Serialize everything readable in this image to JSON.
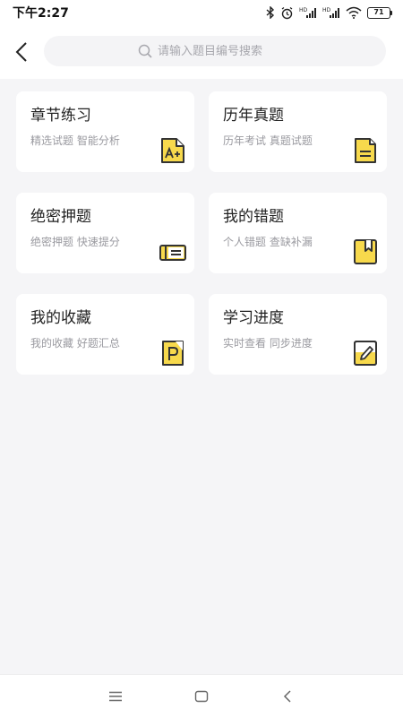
{
  "status_bar": {
    "time": "下午2:27",
    "battery": "71"
  },
  "search": {
    "placeholder": "请输入题目编号搜索"
  },
  "cards": [
    {
      "title": "章节练习",
      "subtitle": "精选试题 智能分析",
      "icon": "grade-a-plus-icon"
    },
    {
      "title": "历年真题",
      "subtitle": "历年考试 真题试题",
      "icon": "document-icon"
    },
    {
      "title": "绝密押题",
      "subtitle": "绝密押题 快速提分",
      "icon": "ticket-icon"
    },
    {
      "title": "我的错题",
      "subtitle": "个人错题 查缺补漏",
      "icon": "bookmark-book-icon"
    },
    {
      "title": "我的收藏",
      "subtitle": "我的收藏 好题汇总",
      "icon": "favorite-page-icon"
    },
    {
      "title": "学习进度",
      "subtitle": "实时查看 同步进度",
      "icon": "pencil-note-icon"
    }
  ],
  "colors": {
    "accent": "#f7d94c",
    "icon_stroke": "#333333",
    "background": "#f5f5f7"
  }
}
